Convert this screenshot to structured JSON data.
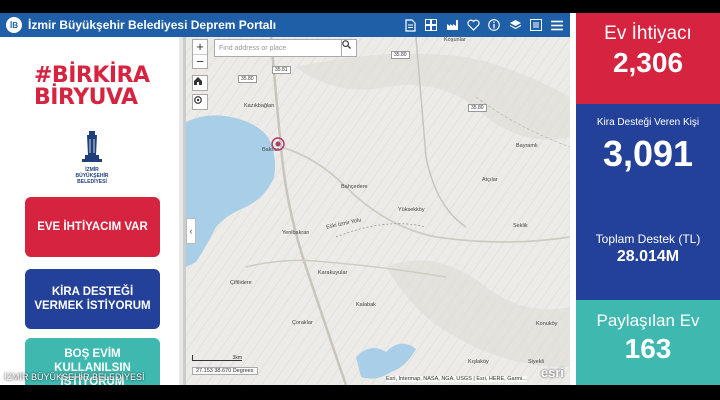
{
  "header": {
    "logo_text": "İB",
    "title": "İzmir Büyükşehir Belediyesi Deprem Portalı",
    "tools": [
      "document-icon",
      "grid-icon",
      "factory-icon",
      "heart-icon",
      "info-icon",
      "layers-icon",
      "list-icon",
      "menu-icon"
    ]
  },
  "left": {
    "hashtag_line1": "#BİRKİRA",
    "hashtag_line2": "BİRYUVA",
    "emblem_text_line1": "İZMİR",
    "emblem_text_line2": "BÜYÜKŞEHİR",
    "emblem_text_line3": "BELEDİYESİ",
    "btn_eve": "EVE İHTİYACIM VAR",
    "btn_kira": "KİRA DESTEĞİ VERMEK İSTİYORUM",
    "btn_bos": "BOŞ EVİM KULLANILSIN İSTİYORUM"
  },
  "map": {
    "search_placeholder": "Find address or place",
    "coords": "27.153 38.670 Degrees",
    "scale_label": "3km",
    "attribution": "Esri, Intermap, NASA, NGA, USGS | Esri, HERE, Garmi...",
    "esri_logo": "esri",
    "places": {
      "kazikbaglari": "Kazıkbağları",
      "bahcedere": "Bahçedere",
      "yuksekkoy": "Yüksekköy",
      "bayramli": "Bayramlı",
      "atciler": "Atçılar",
      "seklik": "Seklik",
      "yenibakran": "Yenibakran",
      "ciftlidere": "Çiftlidere",
      "karakuyular": "Karakuyular",
      "kalabak": "Kalabak",
      "coraklar": "Çoraklar",
      "konukoy": "Konuköy",
      "kislakoy": "Kışlaköy",
      "siyekli": "Siyekli",
      "kosunlar": "Koşunlar",
      "bakran": "Bakran",
      "yeni_yolu": "Eski İzmir Yolu"
    },
    "roads": [
      "35.80",
      "35.81",
      "35.80",
      "35.80"
    ]
  },
  "stats": {
    "ev_label": "Ev İhtiyacı",
    "ev_value": "2,306",
    "kira_label": "Kira Desteği Veren Kişi",
    "kira_value": "3,091",
    "toplam_label": "Toplam Destek (TL)",
    "toplam_value": "28.014M",
    "paylas_label": "Paylaşılan Ev",
    "paylas_value": "163"
  },
  "footer_watermark": "İZMİR BÜYÜKŞEHİR BELEDİYESİ",
  "colors": {
    "red": "#d6233f",
    "navy": "#24419a",
    "teal": "#3fb8b0",
    "header_blue": "#1f5fa8",
    "water": "#a9cfe8"
  }
}
